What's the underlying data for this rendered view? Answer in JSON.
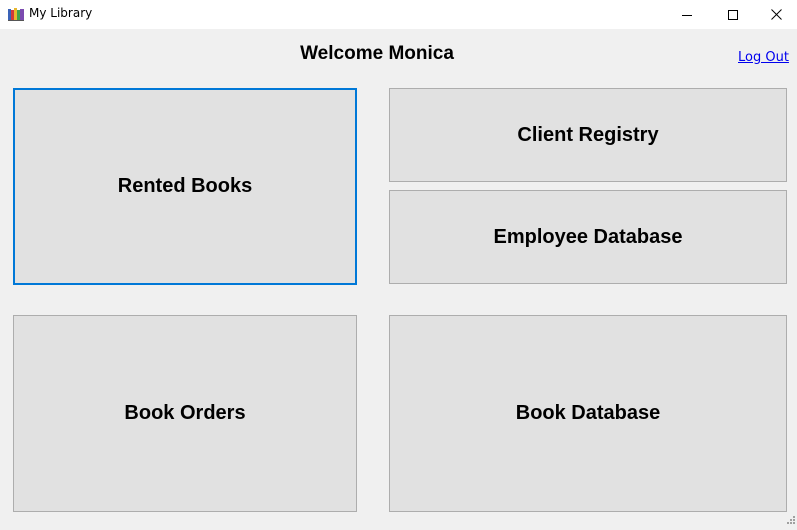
{
  "window": {
    "title": "My Library",
    "icon": "library-books-icon",
    "controls": [
      "minimize-icon",
      "maximize-icon",
      "close-icon"
    ]
  },
  "header": {
    "welcome": "Welcome Monica",
    "logout_label": "Log Out"
  },
  "menu": {
    "rented_books": "Rented Books",
    "client_registry": "Client Registry",
    "employee_database": "Employee Database",
    "book_orders": "Book Orders",
    "book_database": "Book Database"
  },
  "colors": {
    "focus_border": "#0078d7",
    "tile_background": "#e1e1e1",
    "window_background": "#f0f0f0",
    "link": "#0000ee"
  }
}
